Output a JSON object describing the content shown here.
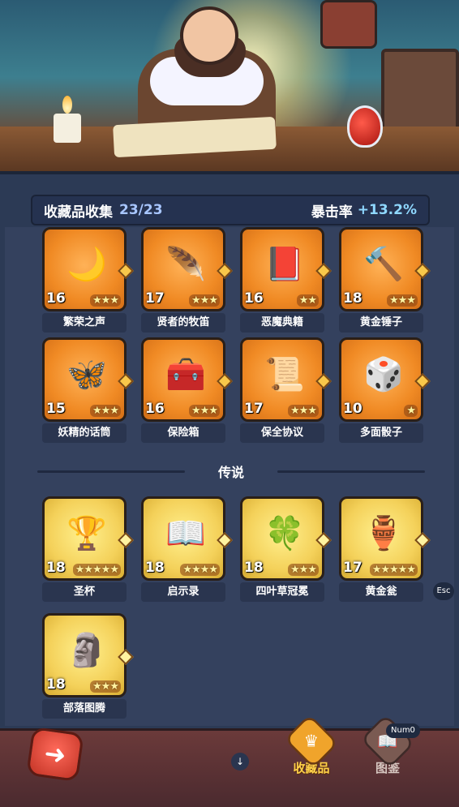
{
  "header": {
    "collection_label": "收藏品收集",
    "collection_count": "23/23",
    "crit_label": "暴击率",
    "crit_bonus": "+13.2%"
  },
  "epic_items": [
    {
      "name": "繁荣之声",
      "level": "16",
      "stars": 3,
      "icon": "moon-bell-icon"
    },
    {
      "name": "贤者的牧笛",
      "level": "17",
      "stars": 3,
      "icon": "flute-icon"
    },
    {
      "name": "恶魔典籍",
      "level": "16",
      "stars": 2,
      "icon": "demon-book-icon"
    },
    {
      "name": "黄金锤子",
      "level": "18",
      "stars": 3,
      "icon": "hammer-icon"
    },
    {
      "name": "妖精的话筒",
      "level": "15",
      "stars": 3,
      "icon": "fairy-mic-icon"
    },
    {
      "name": "保险箱",
      "level": "16",
      "stars": 3,
      "icon": "treasure-chest-icon"
    },
    {
      "name": "保全协议",
      "level": "17",
      "stars": 3,
      "icon": "scroll-icon"
    },
    {
      "name": "多面骰子",
      "level": "10",
      "stars": 1,
      "icon": "dice-icon"
    }
  ],
  "section_legend_label": "传说",
  "legend_items": [
    {
      "name": "圣杯",
      "level": "18",
      "stars": 5,
      "icon": "grail-icon"
    },
    {
      "name": "启示录",
      "level": "18",
      "stars": 4,
      "icon": "open-book-icon"
    },
    {
      "name": "四叶草冠冕",
      "level": "18",
      "stars": 3,
      "icon": "clover-crown-icon"
    },
    {
      "name": "黄金瓮",
      "level": "17",
      "stars": 5,
      "icon": "golden-urn-icon"
    },
    {
      "name": "部落图腾",
      "level": "18",
      "stars": 3,
      "icon": "totem-icon"
    }
  ],
  "esc_label": "Esc",
  "nav": {
    "collectibles_label": "收藏品",
    "codex_label": "图鉴",
    "codex_hotkey": "Num0",
    "scroll_hint": "↓"
  }
}
